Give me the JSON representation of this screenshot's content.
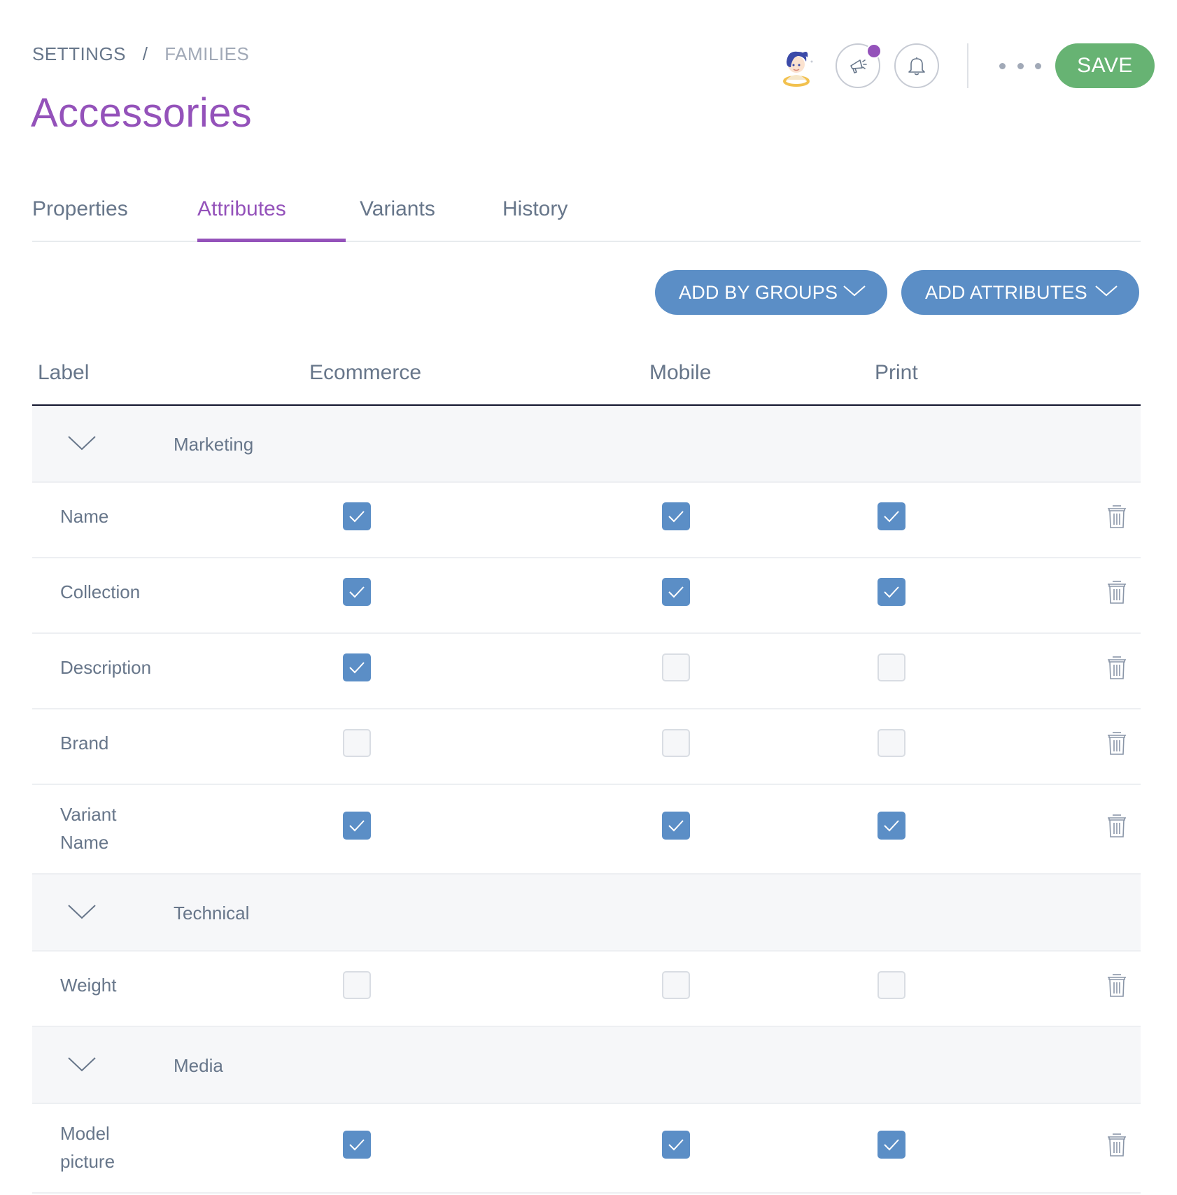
{
  "breadcrumb": {
    "root": "SETTINGS",
    "separator": "/",
    "current": "FAMILIES"
  },
  "page": {
    "title": "Accessories"
  },
  "header": {
    "save_label": "SAVE"
  },
  "tabs": [
    {
      "label": "Properties",
      "active": false
    },
    {
      "label": "Attributes",
      "active": true
    },
    {
      "label": "Variants",
      "active": false
    },
    {
      "label": "History",
      "active": false
    }
  ],
  "actions": {
    "add_by_groups": "ADD BY GROUPS",
    "add_attributes": "ADD ATTRIBUTES"
  },
  "table": {
    "columns": {
      "label": "Label",
      "ecommerce": "Ecommerce",
      "mobile": "Mobile",
      "print": "Print"
    },
    "groups": [
      {
        "name": "Marketing",
        "attributes": [
          {
            "label": "Name",
            "ecommerce": true,
            "mobile": true,
            "print": true
          },
          {
            "label": "Collection",
            "ecommerce": true,
            "mobile": true,
            "print": true
          },
          {
            "label": "Description",
            "ecommerce": true,
            "mobile": false,
            "print": false
          },
          {
            "label": "Brand",
            "ecommerce": false,
            "mobile": false,
            "print": false
          },
          {
            "label": "Variant Name",
            "ecommerce": true,
            "mobile": true,
            "print": true
          }
        ]
      },
      {
        "name": "Technical",
        "attributes": [
          {
            "label": "Weight",
            "ecommerce": false,
            "mobile": false,
            "print": false
          }
        ]
      },
      {
        "name": "Media",
        "attributes": [
          {
            "label": "Model picture",
            "ecommerce": true,
            "mobile": true,
            "print": true
          }
        ]
      }
    ]
  },
  "colors": {
    "accent": "#9452ba",
    "primary": "#5b8ec6",
    "save": "#67b373",
    "text": "#67768a"
  }
}
